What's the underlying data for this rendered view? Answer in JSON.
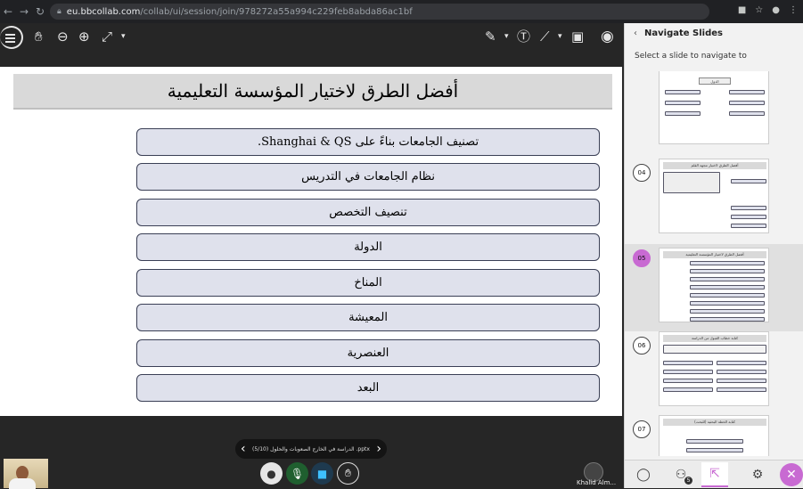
{
  "browser": {
    "url_host": "eu.bbcollab.com",
    "url_path": "/collab/ui/session/join/978272a55a994c229feb8abda86ac1bf"
  },
  "icons": {
    "back": "arrow-left-icon",
    "forward": "arrow-right-icon",
    "reload": "reload-icon",
    "lock": "lock-icon",
    "menu": "menu-icon",
    "pan": "hand-icon",
    "zoom_out": "zoom-out-icon",
    "zoom_in": "zoom-in-icon",
    "fit": "fit-screen-icon",
    "pen": "pen-icon",
    "text": "text-icon",
    "line": "line-icon",
    "shape": "shape-icon",
    "record": "record-icon"
  },
  "slide": {
    "title": "أفضل الطرق لاختيار المؤسسة التعليمية",
    "items": [
      "تصنيف الجامعات بناءً على Shanghai & QS.",
      "نظام الجامعات في التدريس",
      "تنصيف التخصص",
      "الدولة",
      "المناخ",
      "المعيشة",
      "العنصرية",
      "البعد"
    ]
  },
  "slide_nav": {
    "label": "pptx. الدراسة في الخارج الصعوبات والحلول (5/10)"
  },
  "participant": {
    "name": "Khalid Alm..."
  },
  "panel": {
    "title": "Navigate Slides",
    "subtitle": "Select a slide to navigate to",
    "slides": [
      {
        "num": "",
        "title": "الدول"
      },
      {
        "num": "04",
        "title": "أفضل الطرق لاختيار مجهة القلم"
      },
      {
        "num": "05",
        "title": "أفضل الطرق لاختيار المؤسسة التعليمية"
      },
      {
        "num": "06",
        "title": "كتابة خطاب القبول من الدراسة"
      },
      {
        "num": "07",
        "title": "كتابة الخطة البحثية (للبحث)"
      }
    ],
    "badge_count": "5",
    "active_color": "#c86ad2"
  }
}
